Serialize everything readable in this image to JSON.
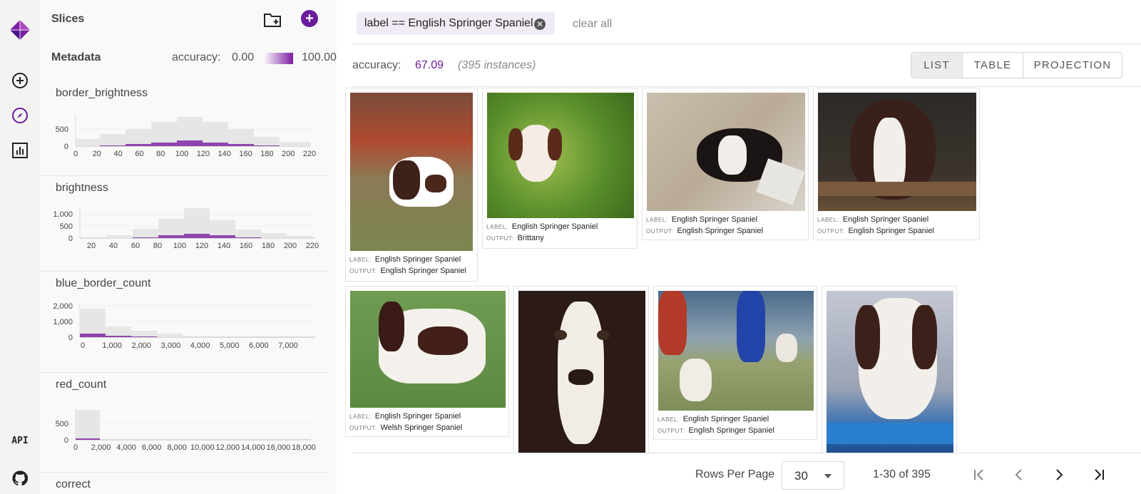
{
  "app": {
    "accent": "#6a1b9a"
  },
  "rail": {
    "icons": [
      "logo-icon",
      "add-circle-icon",
      "explore-compass-icon",
      "bar-chart-icon",
      "api-icon",
      "github-icon"
    ],
    "api_label": "API"
  },
  "sidebar": {
    "slices_title": "Slices",
    "metadata_title": "Metadata",
    "accuracy_label": "accuracy:",
    "accuracy_min": "0.00",
    "accuracy_max": "100.00",
    "histograms": [
      {
        "name": "border_brightness",
        "y_ticks": [
          "500",
          "0"
        ],
        "x_ticks": [
          "0",
          "20",
          "40",
          "60",
          "80",
          "100",
          "120",
          "140",
          "160",
          "180",
          "200",
          "220"
        ]
      },
      {
        "name": "brightness",
        "y_ticks": [
          "1,000",
          "500",
          "0"
        ],
        "x_ticks": [
          "20",
          "40",
          "60",
          "80",
          "100",
          "120",
          "140",
          "160",
          "180",
          "200",
          "220"
        ]
      },
      {
        "name": "blue_border_count",
        "y_ticks": [
          "2,000",
          "1,000",
          "0"
        ],
        "x_ticks": [
          "0",
          "1,000",
          "2,000",
          "3,000",
          "4,000",
          "5,000",
          "6,000",
          "7,000"
        ]
      },
      {
        "name": "red_count",
        "y_ticks": [
          "500",
          "0"
        ],
        "x_ticks": [
          "0",
          "2,000",
          "4,000",
          "6,000",
          "8,000",
          "10,000",
          "12,000",
          "14,000",
          "16,000",
          "18,000"
        ]
      },
      {
        "name": "correct"
      }
    ]
  },
  "main": {
    "filter_chip": "label == English Springer Spaniel",
    "clear_all": "clear all",
    "accuracy_label": "accuracy:",
    "accuracy_value": "67.09",
    "instances": "(395 instances)",
    "view_tabs": [
      "LIST",
      "TABLE",
      "PROJECTION"
    ],
    "active_tab": "LIST",
    "label_key": "LABEL:",
    "output_key": "OUTPUT:",
    "cards": [
      {
        "label": "English Springer Spaniel",
        "output": "English Springer Spaniel"
      },
      {
        "label": "English Springer Spaniel",
        "output": "Brittany"
      },
      {
        "label": "English Springer Spaniel",
        "output": "English Springer Spaniel"
      },
      {
        "label": "English Springer Spaniel",
        "output": "English Springer Spaniel"
      },
      {
        "label": "English Springer Spaniel",
        "output": "Welsh Springer Spaniel"
      },
      {
        "label": "",
        "output": ""
      },
      {
        "label": "English Springer Spaniel",
        "output": "English Springer Spaniel"
      },
      {
        "label": "",
        "output": ""
      }
    ],
    "rows_per_page_label": "Rows Per Page",
    "rows_per_page_value": "30",
    "page_range": "1-30 of 395"
  }
}
